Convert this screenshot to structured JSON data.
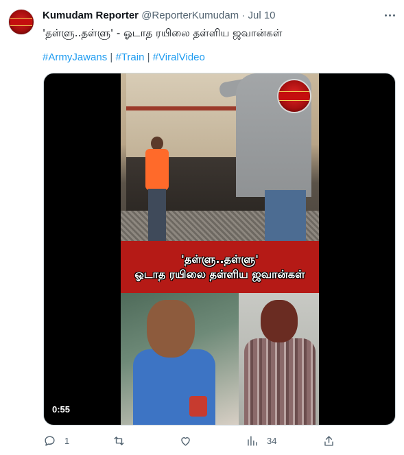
{
  "author": {
    "name": "Kumudam Reporter",
    "handle": "@ReporterKumudam",
    "separator": "·",
    "date": "Jul 10",
    "avatar_icon": "kumudam-reporter-logo"
  },
  "tweet": {
    "text": "'தள்ளு..தள்ளு' - ஓடாத ரயிலை தள்ளிய ஜவான்கள்",
    "hashtags": [
      "#ArmyJawans",
      "#Train",
      "#ViralVideo"
    ],
    "hashtag_separator": "|"
  },
  "media": {
    "banner_line1": "'தள்ளு..தள்ளு'",
    "banner_line2": "ஓடாத ரயிலை தள்ளிய ஜவான்கள்",
    "duration": "0:55",
    "logo_icon": "kumudam-reporter-logo"
  },
  "actions": {
    "reply_count": "1",
    "retweet_count": "",
    "like_count": "",
    "views_count": "34"
  },
  "colors": {
    "link": "#1d9bf0",
    "secondary_text": "#536471",
    "banner_red": "#b51a16"
  }
}
